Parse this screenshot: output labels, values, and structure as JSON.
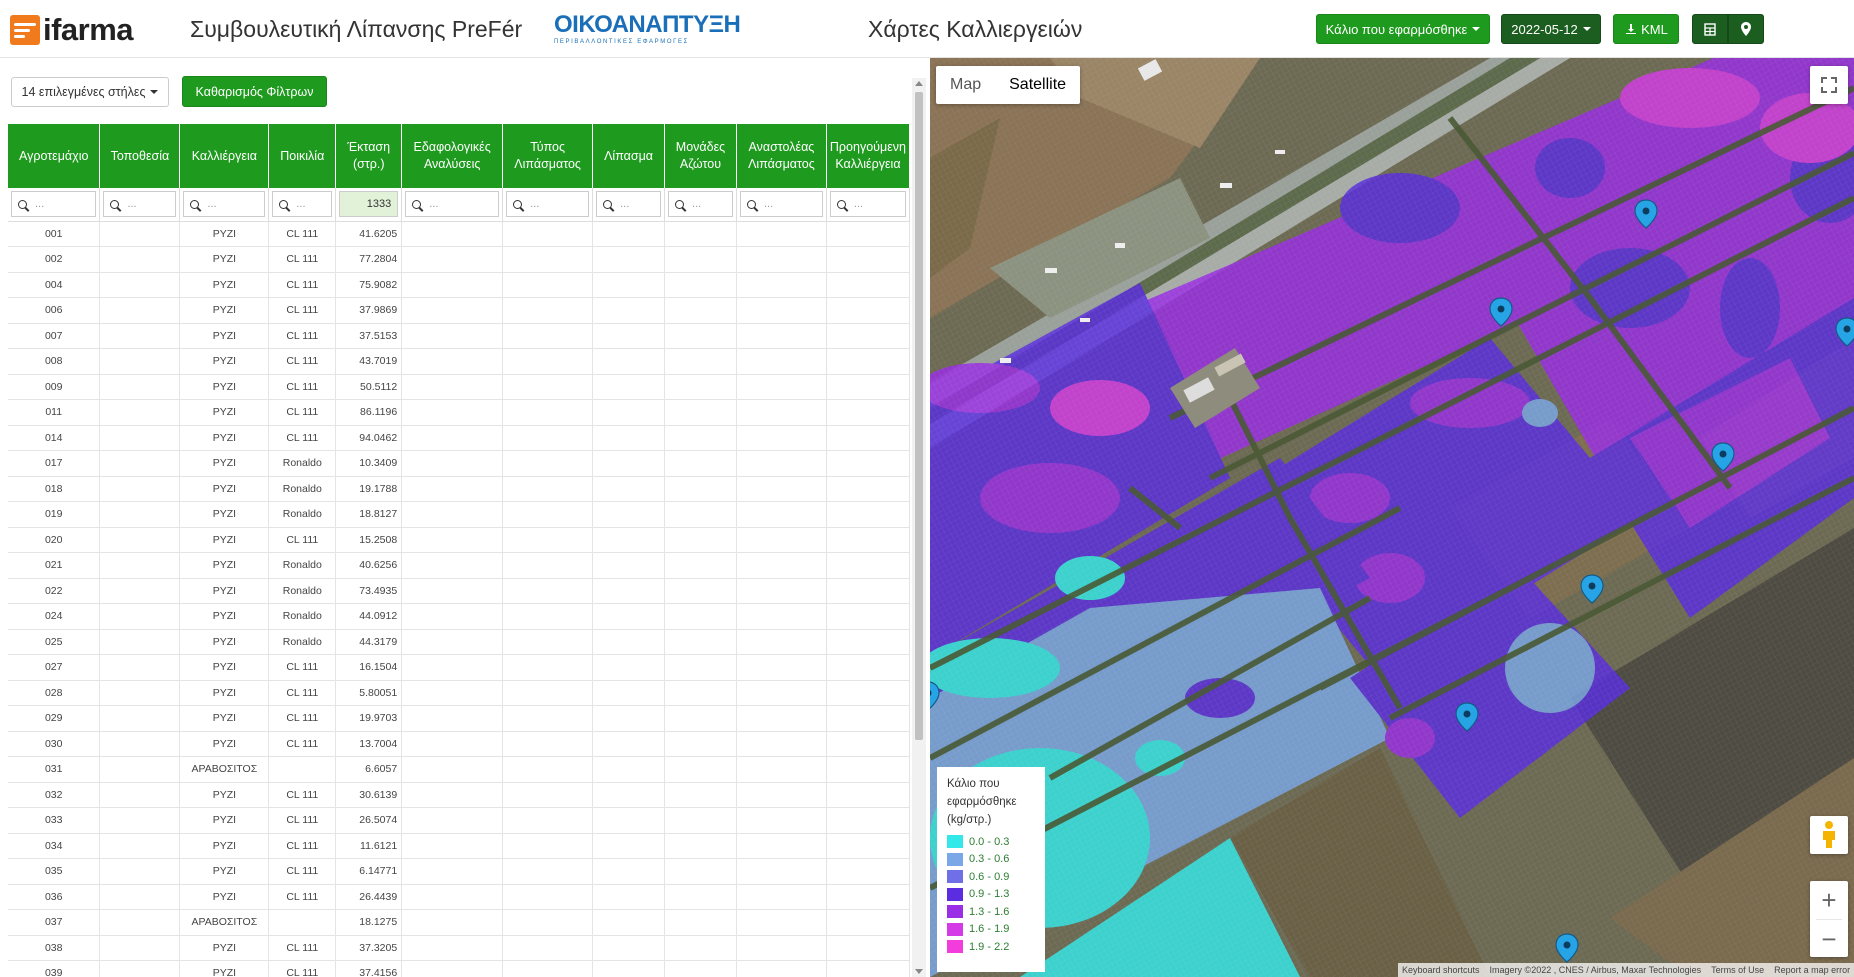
{
  "header": {
    "logo_text": "ifarma",
    "app_title": "Συμβουλευτική Λίπανσης PreFér",
    "partner_main": "ΟΙΚΟΑΝΑΠΤΥΞΗ",
    "partner_sub": "ΠΕΡΙΒΑΛΛΟΝΤΙΚΕΣ ΕΦΑΡΜΟΓΕΣ",
    "page_title": "Χάρτες Καλλιεργειών",
    "layer_select": "Κάλιο που εφαρμόσθηκε",
    "date_select": "2022-05-12",
    "kml_label": "KML",
    "accent_color": "#1e9a1e",
    "dark_color": "#1b5e20"
  },
  "toolbar": {
    "columns_filter": "14 επιλεγμένες στήλες",
    "clear_filters": "Καθαρισμός Φίλτρων"
  },
  "table": {
    "columns": [
      "Αγροτεμάχιο",
      "Τοποθεσία",
      "Καλλιέργεια",
      "Ποικιλία",
      "Έκταση (στρ.)",
      "Εδαφολογικές Αναλύσεις",
      "Τύπος Λιπάσματος",
      "Λίπασμα",
      "Μονάδες Αζώτου",
      "Αναστολέας Λιπάσματος",
      "Προηγούμενη Καλλιέργεια"
    ],
    "search_placeholder": "...",
    "area_total": "1333",
    "rows": [
      [
        "001",
        "",
        "ΡΥΖΙ",
        "CL 111",
        "41.6205"
      ],
      [
        "002",
        "",
        "ΡΥΖΙ",
        "CL 111",
        "77.2804"
      ],
      [
        "004",
        "",
        "ΡΥΖΙ",
        "CL 111",
        "75.9082"
      ],
      [
        "006",
        "",
        "ΡΥΖΙ",
        "CL 111",
        "37.9869"
      ],
      [
        "007",
        "",
        "ΡΥΖΙ",
        "CL 111",
        "37.5153"
      ],
      [
        "008",
        "",
        "ΡΥΖΙ",
        "CL 111",
        "43.7019"
      ],
      [
        "009",
        "",
        "ΡΥΖΙ",
        "CL 111",
        "50.5112"
      ],
      [
        "011",
        "",
        "ΡΥΖΙ",
        "CL 111",
        "86.1196"
      ],
      [
        "014",
        "",
        "ΡΥΖΙ",
        "CL 111",
        "94.0462"
      ],
      [
        "017",
        "",
        "ΡΥΖΙ",
        "Ronaldo",
        "10.3409"
      ],
      [
        "018",
        "",
        "ΡΥΖΙ",
        "Ronaldo",
        "19.1788"
      ],
      [
        "019",
        "",
        "ΡΥΖΙ",
        "Ronaldo",
        "18.8127"
      ],
      [
        "020",
        "",
        "ΡΥΖΙ",
        "CL 111",
        "15.2508"
      ],
      [
        "021",
        "",
        "ΡΥΖΙ",
        "Ronaldo",
        "40.6256"
      ],
      [
        "022",
        "",
        "ΡΥΖΙ",
        "Ronaldo",
        "73.4935"
      ],
      [
        "024",
        "",
        "ΡΥΖΙ",
        "Ronaldo",
        "44.0912"
      ],
      [
        "025",
        "",
        "ΡΥΖΙ",
        "Ronaldo",
        "44.3179"
      ],
      [
        "027",
        "",
        "ΡΥΖΙ",
        "CL 111",
        "16.1504"
      ],
      [
        "028",
        "",
        "ΡΥΖΙ",
        "CL 111",
        "5.80051"
      ],
      [
        "029",
        "",
        "ΡΥΖΙ",
        "CL 111",
        "19.9703"
      ],
      [
        "030",
        "",
        "ΡΥΖΙ",
        "CL 111",
        "13.7004"
      ],
      [
        "031",
        "",
        "ΑΡΑΒΟΣΙΤΟΣ",
        "",
        "6.6057"
      ],
      [
        "032",
        "",
        "ΡΥΖΙ",
        "CL 111",
        "30.6139"
      ],
      [
        "033",
        "",
        "ΡΥΖΙ",
        "CL 111",
        "26.5074"
      ],
      [
        "034",
        "",
        "ΡΥΖΙ",
        "CL 111",
        "11.6121"
      ],
      [
        "035",
        "",
        "ΡΥΖΙ",
        "CL 111",
        "6.14771"
      ],
      [
        "036",
        "",
        "ΡΥΖΙ",
        "CL 111",
        "26.4439"
      ],
      [
        "037",
        "",
        "ΑΡΑΒΟΣΙΤΟΣ",
        "",
        "18.1275"
      ],
      [
        "038",
        "",
        "ΡΥΖΙ",
        "CL 111",
        "37.3205"
      ],
      [
        "039",
        "",
        "ΡΥΖΙ",
        "CL 111",
        "37.4156"
      ]
    ]
  },
  "map": {
    "type_map": "Map",
    "type_satellite": "Satellite",
    "legend_title": "Κάλιο που εφαρμόσθηκε (kg/στρ.)",
    "legend": [
      {
        "label": "0.0 - 0.3",
        "color": "#33e8e8"
      },
      {
        "label": "0.3 - 0.6",
        "color": "#7aa8e6"
      },
      {
        "label": "0.6 - 0.9",
        "color": "#6f6fe8"
      },
      {
        "label": "0.9 - 1.3",
        "color": "#5a2ee0"
      },
      {
        "label": "1.3 - 1.6",
        "color": "#9a2ee6"
      },
      {
        "label": "1.6 - 1.9",
        "color": "#d43ae6"
      },
      {
        "label": "1.9 - 2.2",
        "color": "#f23cdc"
      }
    ],
    "attribution": [
      "Keyboard shortcuts",
      "Imagery ©2022 , CNES / Airbus, Maxar Technologies",
      "Terms of Use",
      "Report a map error"
    ]
  }
}
